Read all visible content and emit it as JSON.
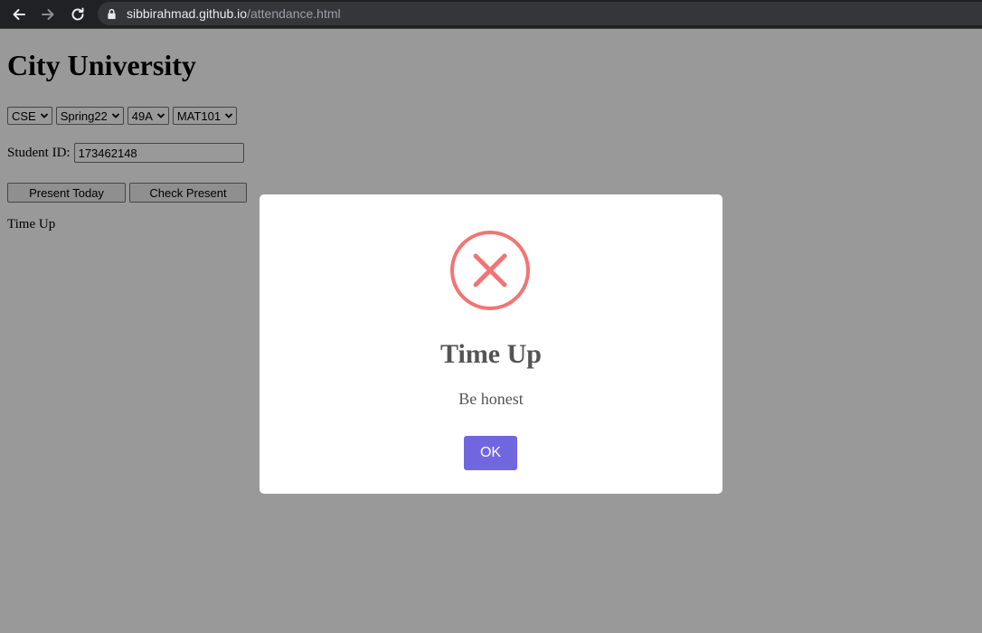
{
  "browser": {
    "url_host": "sibbirahmad.github.io",
    "url_path": "/attendance.html"
  },
  "page": {
    "title": "City University",
    "selects": [
      {
        "name": "department",
        "value": "CSE"
      },
      {
        "name": "semester",
        "value": "Spring22"
      },
      {
        "name": "section",
        "value": "49A"
      },
      {
        "name": "course",
        "value": "MAT101"
      }
    ],
    "student_id_label": "Student ID:",
    "student_id_value": "173462148",
    "present_today_label": "Present Today",
    "check_present_label": "Check Present",
    "status_text": "Time Up"
  },
  "modal": {
    "title": "Time Up",
    "text": "Be honest",
    "ok_label": "OK",
    "icon": "error-x-icon",
    "icon_color": "#f27474",
    "ok_color": "#7066e0"
  }
}
